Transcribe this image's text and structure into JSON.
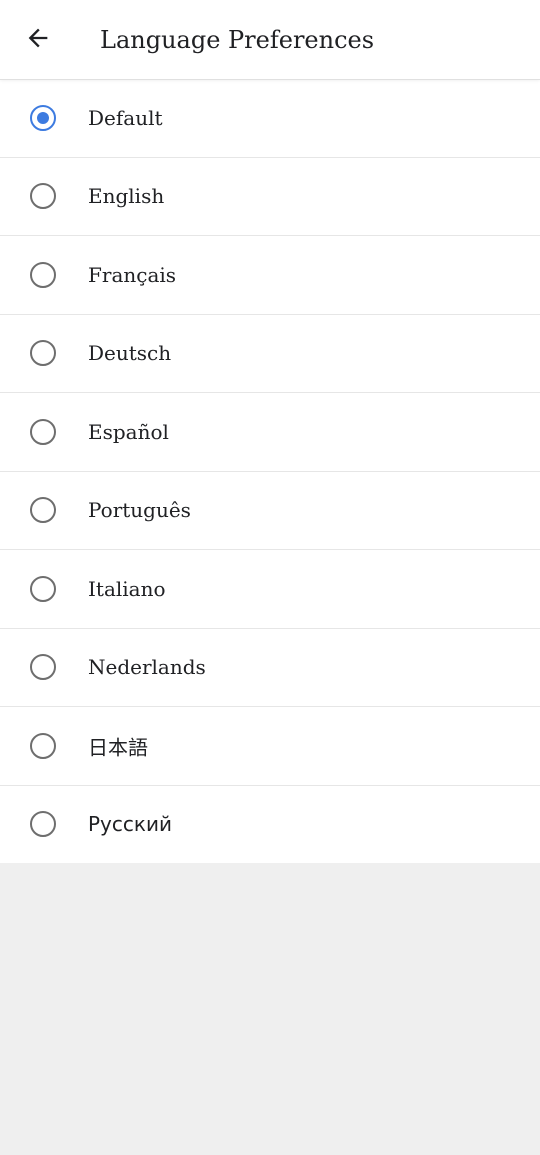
{
  "header": {
    "title": "Language Preferences",
    "back_icon": "arrow-left-icon"
  },
  "languages": [
    {
      "label": "Default",
      "selected": true
    },
    {
      "label": "English",
      "selected": false
    },
    {
      "label": "Français",
      "selected": false
    },
    {
      "label": "Deutsch",
      "selected": false
    },
    {
      "label": "Español",
      "selected": false
    },
    {
      "label": "Português",
      "selected": false
    },
    {
      "label": "Italiano",
      "selected": false
    },
    {
      "label": "Nederlands",
      "selected": false
    },
    {
      "label": "日本語",
      "selected": false
    },
    {
      "label": "Русский",
      "selected": false
    }
  ],
  "colors": {
    "accent": "#3d7be0",
    "radio_off": "#6e6e6e",
    "text": "#202124",
    "background": "#efefef"
  }
}
